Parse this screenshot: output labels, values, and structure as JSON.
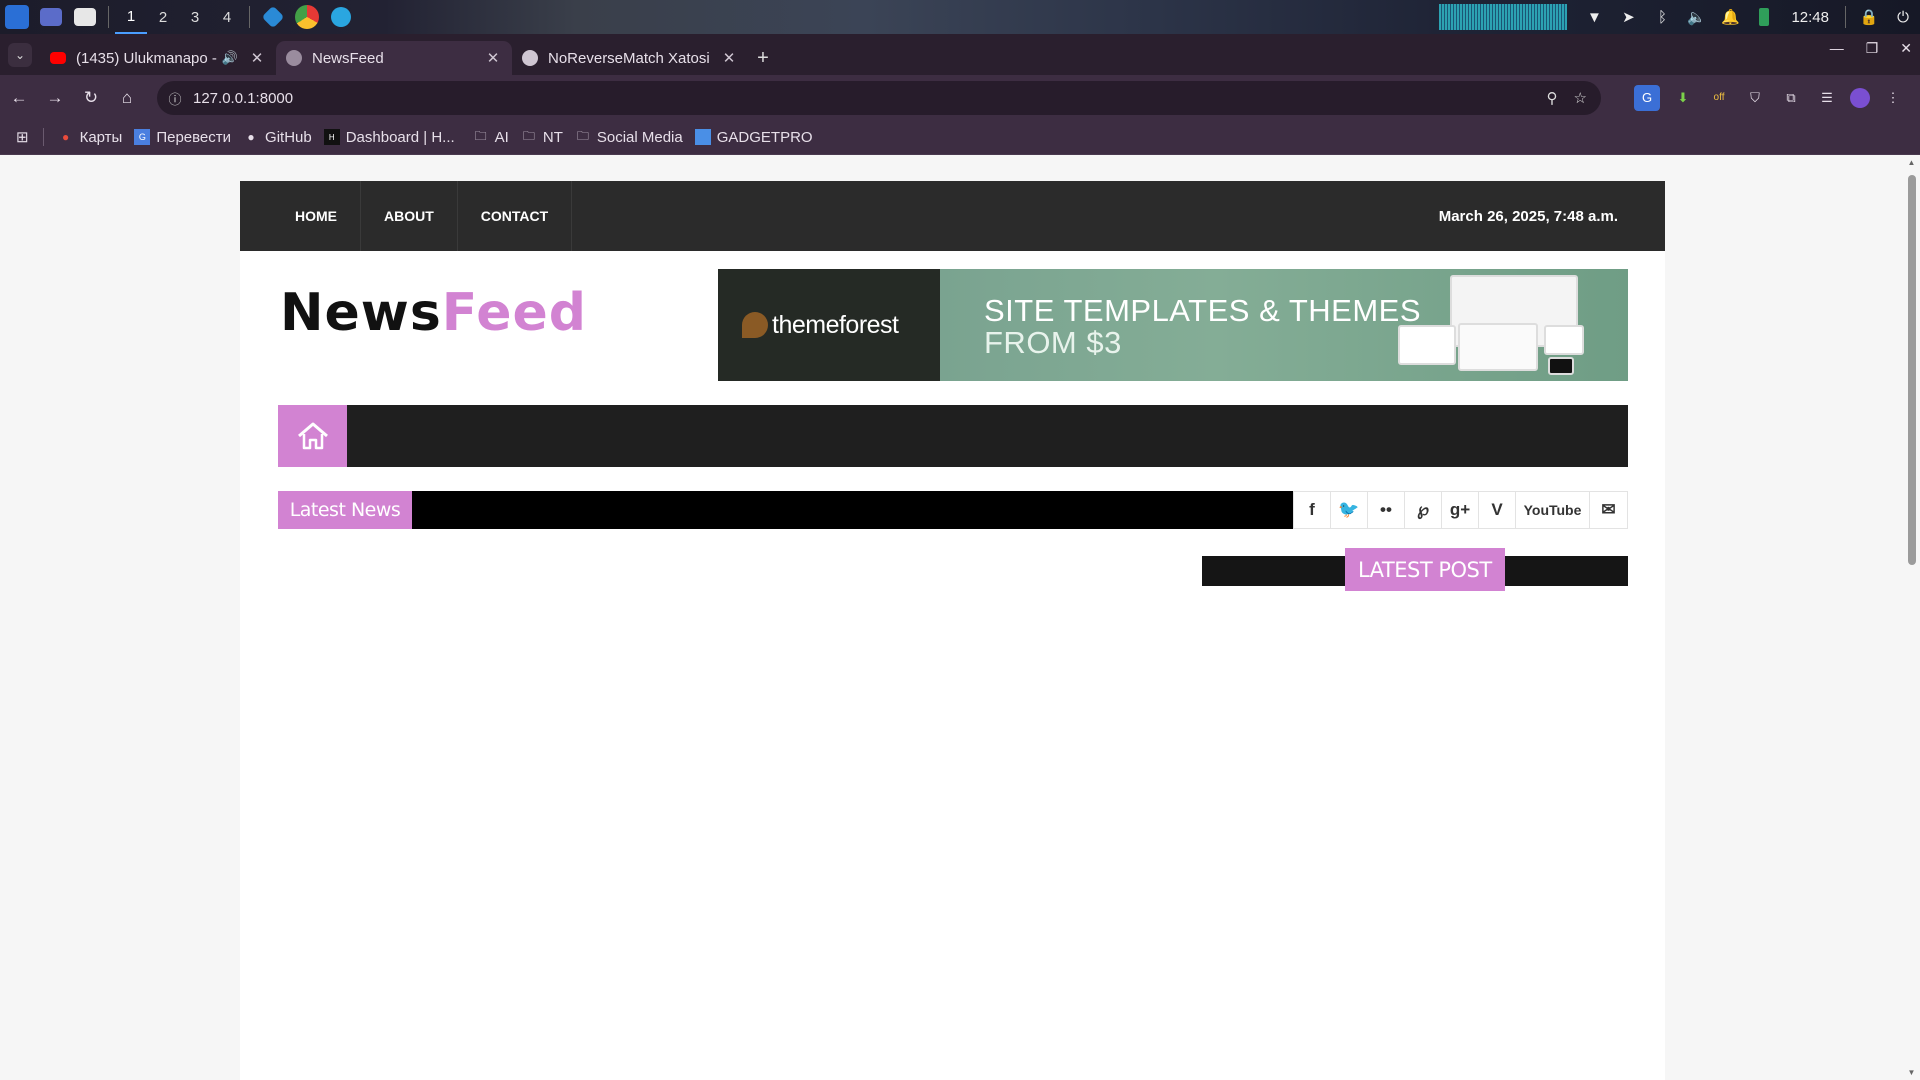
{
  "taskbar": {
    "workspaces": [
      "1",
      "2",
      "3",
      "4"
    ],
    "clock": "12:48"
  },
  "browser": {
    "tabs": [
      {
        "title": "(1435) Ulukmanapo - (",
        "favicon_color": "#ff0000"
      },
      {
        "title": "NewsFeed",
        "favicon_color": "#9a8c9e"
      },
      {
        "title": "NoReverseMatch Xatosi",
        "favicon_color": "#cfc6d2"
      }
    ],
    "url": "127.0.0.1:8000",
    "bookmarks": [
      "Карты",
      "Перевести",
      "GitHub",
      "Dashboard | H...",
      "AI",
      "NT",
      "Social Media",
      "GADGETPRO"
    ]
  },
  "site": {
    "nav": [
      "HOME",
      "ABOUT",
      "CONTACT"
    ],
    "datetime": "March 26, 2025, 7:48 a.m.",
    "logo": {
      "part1": "News",
      "part2": "Feed"
    },
    "banner": {
      "brand": "themeforest",
      "line1": "SITE TEMPLATES & THEMES",
      "line2": "FROM $3"
    },
    "ticker_label": "Latest News",
    "social": {
      "youtube": "YouTube"
    },
    "latest_post": "LATEST POST",
    "accent_color": "#d283d2"
  }
}
